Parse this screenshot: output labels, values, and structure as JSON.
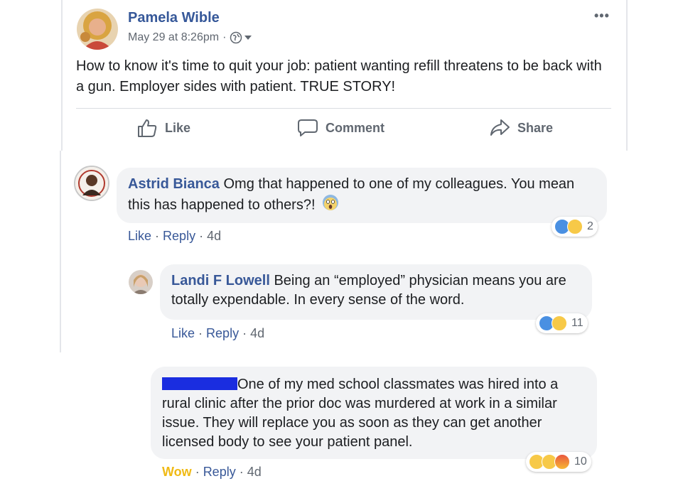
{
  "post": {
    "author": "Pamela Wible",
    "timestamp": "May 29 at 8:26pm",
    "meta_separator": "·",
    "more_icon": "•••",
    "text": "How to know it's time to quit your job: patient wanting refill threatens to be back with a gun. Employer sides with patient. TRUE STORY!",
    "actions": {
      "like": "Like",
      "comment": "Comment",
      "share": "Share"
    }
  },
  "comments": [
    {
      "author": "Astrid Bianca",
      "text": "Omg that happened to one of my colleagues. You mean this has happened to others?!",
      "like": "Like",
      "reply": "Reply",
      "age": "4d",
      "reaction_count": "2",
      "reactions": [
        "like-reaction",
        "wow-reaction"
      ]
    },
    {
      "author": "Landi F Lowell",
      "text": "Being an “employed” physician means you are totally expendable. In every sense of the word.",
      "like": "Like",
      "reply": "Reply",
      "age": "4d",
      "reaction_count": "11",
      "reactions": [
        "like-reaction",
        "sad-reaction"
      ]
    },
    {
      "author": "",
      "text": "One of my med school classmates was hired into a rural clinic after the prior doc was murdered at work in a similar issue. They will replace you as soon as they can get another licensed body to see your patient panel.",
      "like": "Wow",
      "reply": "Reply",
      "age": "4d",
      "reaction_count": "10",
      "reactions": [
        "sad-reaction",
        "wow-reaction",
        "angry-reaction"
      ]
    }
  ],
  "colors": {
    "link": "#385898",
    "wow_label": "#f0ba15",
    "redaction": "#1a2de0",
    "bubble": "#f2f3f5"
  }
}
